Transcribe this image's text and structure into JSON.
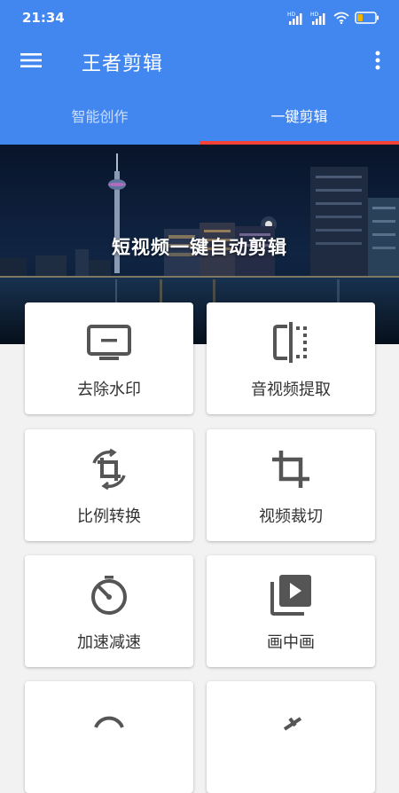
{
  "statusbar": {
    "time": "21:34",
    "signal_1_label": "HD",
    "signal_2_label": "HD",
    "icons": [
      "signal-icon",
      "signal-icon",
      "wifi-icon",
      "battery-icon"
    ]
  },
  "appbar": {
    "title": "王者剪辑",
    "menu_icon": "hamburger-menu-icon",
    "more_icon": "more-vert-icon"
  },
  "tabs": [
    {
      "label": "智能创作",
      "active": false
    },
    {
      "label": "一键剪辑",
      "active": true
    }
  ],
  "banner": {
    "text": "短视频一键自动剪辑"
  },
  "tools": [
    {
      "label": "去除水印",
      "icon": "tv-icon"
    },
    {
      "label": "音视频提取",
      "icon": "split-icon"
    },
    {
      "label": "比例转换",
      "icon": "crop-rotate-icon"
    },
    {
      "label": "视频裁切",
      "icon": "crop-icon"
    },
    {
      "label": "加速减速",
      "icon": "speed-icon"
    },
    {
      "label": "画中画",
      "icon": "video-library-icon"
    }
  ],
  "colors": {
    "primary": "#4286f0",
    "tab_indicator": "#f44336",
    "icon": "#555555",
    "background": "#f2f2f2"
  }
}
